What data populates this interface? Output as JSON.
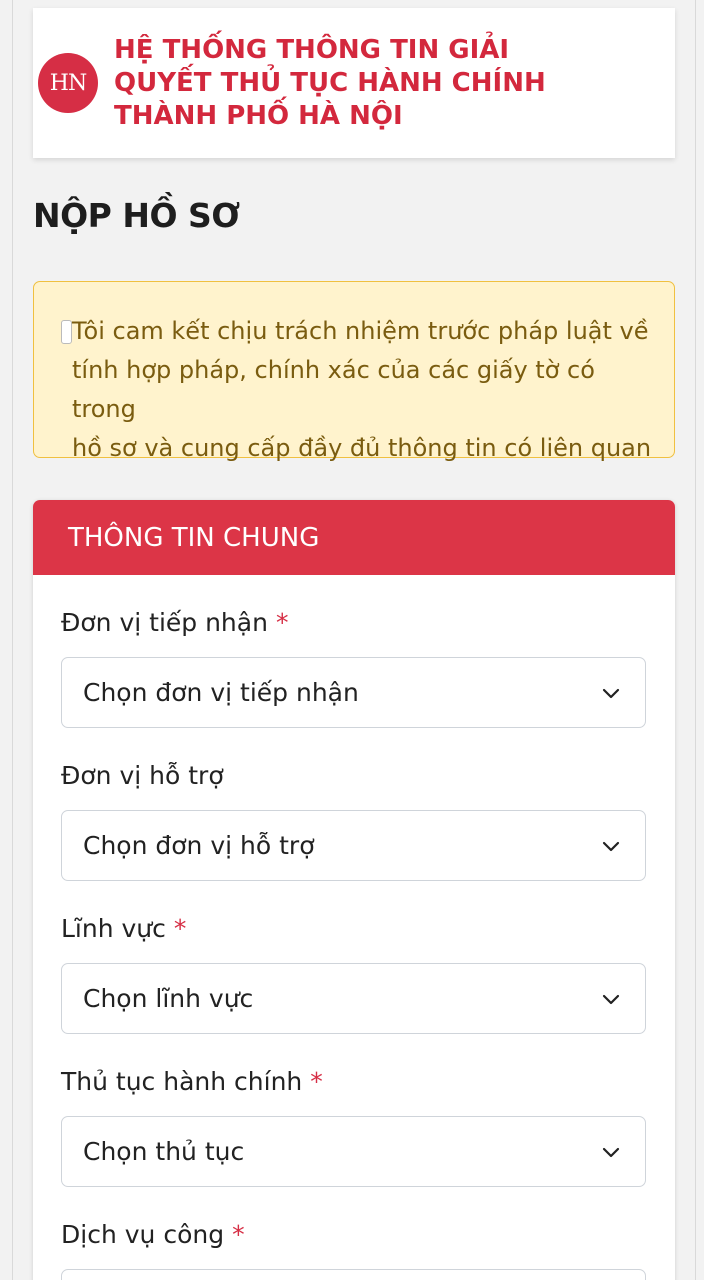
{
  "header": {
    "logo_text": "HN",
    "title_lines": [
      "HỆ THỐNG THÔNG TIN GIẢI",
      "QUYẾT THỦ TỤC HÀNH CHÍNH",
      "THÀNH PHỐ HÀ NỘI"
    ]
  },
  "page_title": "NỘP HỒ SƠ",
  "notice": {
    "lines": [
      "Tôi cam kết chịu trách nhiệm trước pháp luật về",
      "tính hợp pháp, chính xác của các giấy tờ có trong",
      "hồ sơ và cung cấp đầy đủ thông tin có liên quan"
    ]
  },
  "section": {
    "title": "THÔNG TIN CHUNG",
    "required_mark": "*",
    "fields": [
      {
        "label": "Đơn vị tiếp nhận",
        "placeholder": "Chọn đơn vị tiếp nhận"
      },
      {
        "label": "Đơn vị hỗ trợ",
        "placeholder": "Chọn đơn vị hỗ trợ"
      },
      {
        "label": "Lĩnh vực",
        "placeholder": "Chọn lĩnh vực"
      },
      {
        "label": "Thủ tục hành chính",
        "placeholder": "Chọn thủ tục"
      },
      {
        "label": "Dịch vụ công",
        "placeholder": ""
      }
    ]
  },
  "colors": {
    "brand_red": "#dc3547",
    "notice_bg": "#fff3cd",
    "notice_border": "#f0c040"
  }
}
